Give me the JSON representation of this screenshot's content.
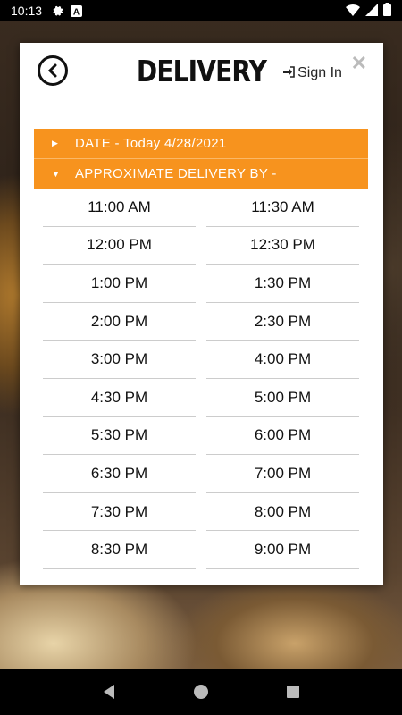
{
  "status_bar": {
    "time": "10:13",
    "icons": [
      "gear-icon",
      "a-icon",
      "wifi-icon",
      "signal-icon",
      "battery-icon"
    ]
  },
  "header": {
    "title": "DELIVERY",
    "sign_in_label": "Sign In",
    "close_label": "✕"
  },
  "date_bar": {
    "label": "DATE - Today 4/28/2021"
  },
  "approx_bar": {
    "label": "APPROXIMATE DELIVERY BY -"
  },
  "time_slots": [
    "11:00 AM",
    "11:30 AM",
    "12:00 PM",
    "12:30 PM",
    "1:00 PM",
    "1:30 PM",
    "2:00 PM",
    "2:30 PM",
    "3:00 PM",
    "4:00 PM",
    "4:30 PM",
    "5:00 PM",
    "5:30 PM",
    "6:00 PM",
    "6:30 PM",
    "7:00 PM",
    "7:30 PM",
    "8:00 PM",
    "8:30 PM",
    "9:00 PM"
  ],
  "colors": {
    "accent": "#f7931e",
    "text": "#111111",
    "divider": "#cccccc"
  }
}
